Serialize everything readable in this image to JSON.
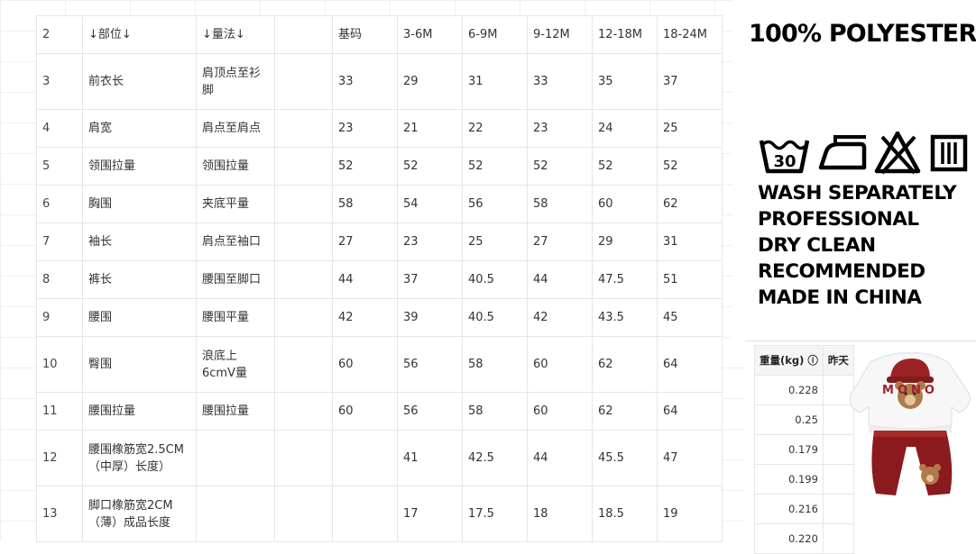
{
  "size_chart": {
    "header": {
      "row_num": "2",
      "part": "↓部位↓",
      "method": "↓量法↓",
      "blank": "",
      "base": "基码",
      "sizes": [
        "3-6M",
        "6-9M",
        "9-12M",
        "12-18M",
        "18-24M"
      ]
    },
    "rows": [
      {
        "num": "3",
        "part": "前衣长",
        "method": "肩顶点至衫脚",
        "base": "33",
        "vals": [
          "29",
          "31",
          "33",
          "35",
          "37"
        ]
      },
      {
        "num": "4",
        "part": "肩宽",
        "method": "肩点至肩点",
        "base": "23",
        "vals": [
          "21",
          "22",
          "23",
          "24",
          "25"
        ]
      },
      {
        "num": "5",
        "part": "领围拉量",
        "method": "领围拉量",
        "base": "52",
        "vals": [
          "52",
          "52",
          "52",
          "52",
          "52"
        ]
      },
      {
        "num": "6",
        "part": "胸围",
        "method": "夹底平量",
        "base": "58",
        "vals": [
          "54",
          "56",
          "58",
          "60",
          "62"
        ]
      },
      {
        "num": "7",
        "part": "袖长",
        "method": "肩点至袖口",
        "base": "27",
        "vals": [
          "23",
          "25",
          "27",
          "29",
          "31"
        ]
      },
      {
        "num": "8",
        "part": "裤长",
        "method": "腰围至脚口",
        "base": "44",
        "vals": [
          "37",
          "40.5",
          "44",
          "47.5",
          "51"
        ]
      },
      {
        "num": "9",
        "part": "腰围",
        "method": "腰围平量",
        "base": "42",
        "vals": [
          "39",
          "40.5",
          "42",
          "43.5",
          "45"
        ]
      },
      {
        "num": "10",
        "part": "臀围",
        "method": "浪底上6cmV量",
        "base": "60",
        "vals": [
          "56",
          "58",
          "60",
          "62",
          "64"
        ]
      },
      {
        "num": "11",
        "part": "腰围拉量",
        "method": "腰围拉量",
        "base": "60",
        "vals": [
          "56",
          "58",
          "60",
          "62",
          "64"
        ]
      },
      {
        "num": "12",
        "part": "腰围橡筋宽2.5CM（中厚）长度）",
        "method": "",
        "base": "",
        "vals": [
          "41",
          "42.5",
          "44",
          "45.5",
          "47"
        ]
      },
      {
        "num": "13",
        "part": "脚口橡筋宽2CM（薄）成品长度",
        "method": "",
        "base": "",
        "vals": [
          "17",
          "17.5",
          "18",
          "18.5",
          "19"
        ]
      }
    ]
  },
  "care_label": {
    "title": "100% POLYESTER",
    "icons": [
      "wash-30-icon",
      "iron-icon",
      "do-not-bleach-icon",
      "dry-clean-icon"
    ],
    "icon_text": {
      "wash_temp": "30"
    },
    "lines": [
      "WASH SEPARATELY",
      "PROFESSIONAL",
      "DRY CLEAN",
      "RECOMMENDED",
      "MADE IN CHINA"
    ]
  },
  "weight_table": {
    "headers": [
      "重量(kg) ⓘ",
      "昨天"
    ],
    "values": [
      "0.228",
      "0.25",
      "0.179",
      "0.199",
      "0.216",
      "0.220"
    ]
  },
  "product": {
    "sweater_text": "MONO",
    "colors": {
      "sweater": "#f7f7f7",
      "pants": "#8b1a1f",
      "hat": "#9b2226",
      "bear": "#b07a4a"
    }
  }
}
